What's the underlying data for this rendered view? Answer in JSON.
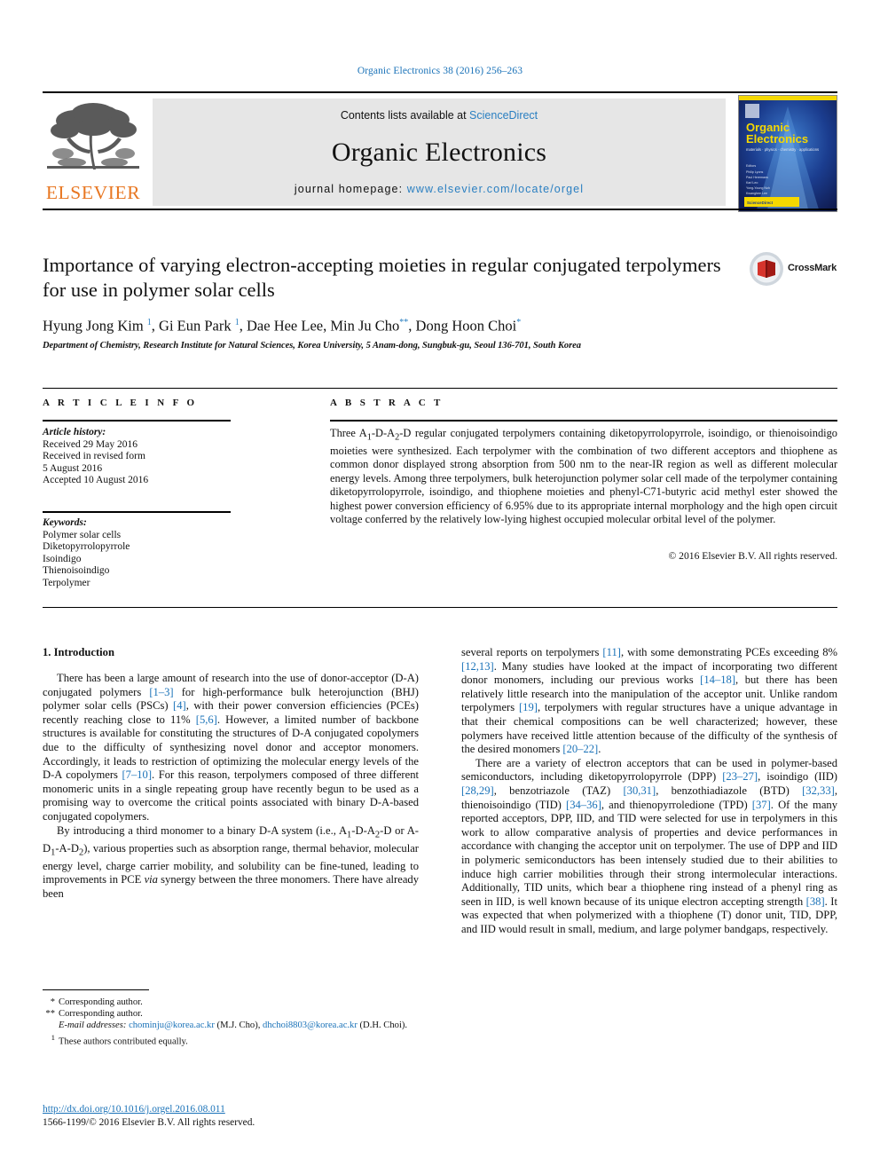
{
  "running_head": "Organic Electronics 38 (2016) 256–263",
  "masthead": {
    "contents_prefix": "Contents lists available at ",
    "sciencedirect": "ScienceDirect",
    "journal_title": "Organic Electronics",
    "homepage_prefix": "journal homepage: ",
    "homepage_url": "www.elsevier.com/locate/orgel",
    "publisher_logo_text": "ELSEVIER",
    "cover_title_line1": "Organic",
    "cover_title_line2": "Electronics",
    "cover_subtitle": "materials · physics · chemistry · applications"
  },
  "colors": {
    "link": "#1a72b8",
    "sciencedirect": "#2a7fc1",
    "elsevier_orange": "#E87722",
    "band_gray": "#e6e6e6",
    "cover_blue": "#1d2b6b",
    "cover_yellow": "#f5d800"
  },
  "article": {
    "title": "Importance of varying electron-accepting moieties in regular conjugated terpolymers for use in polymer solar cells",
    "authors_html": "Hyung Jong Kim <sup>1</sup>, Gi Eun Park <sup>1</sup>, Dae Hee Lee, Min Ju Cho<sup class=\"star\">**</sup>, Dong Hoon Choi<sup class=\"star\">*</sup>",
    "affiliation": "Department of Chemistry, Research Institute for Natural Sciences, Korea University, 5 Anam-dong, Sungbuk-gu, Seoul 136-701, South Korea",
    "crossmark_label": "CrossMark"
  },
  "article_info": {
    "heading": "A R T I C L E  I N F O",
    "history_label": "Article history:",
    "history": [
      "Received 29 May 2016",
      "Received in revised form",
      "5 August 2016",
      "Accepted 10 August 2016"
    ],
    "keywords_label": "Keywords:",
    "keywords": [
      "Polymer solar cells",
      "Diketopyrrolopyrrole",
      "Isoindigo",
      "Thienoisoindigo",
      "Terpolymer"
    ]
  },
  "abstract": {
    "heading": "A B S T R A C T",
    "text": "Three A1-D-A2-D regular conjugated terpolymers containing diketopyrrolopyrrole, isoindigo, or thienoisoindigo moieties were synthesized. Each terpolymer with the combination of two different acceptors and thiophene as common donor displayed strong absorption from 500 nm to the near-IR region as well as different molecular energy levels. Among three terpolymers, bulk heterojunction polymer solar cell made of the terpolymer containing diketopyrrolopyrrole, isoindigo, and thiophene moieties and phenyl-C71-butyric acid methyl ester showed the highest power conversion efficiency of 6.95% due to its appropriate internal morphology and the high open circuit voltage conferred by the relatively low-lying highest occupied molecular orbital level of the polymer.",
    "copyright": "© 2016 Elsevier B.V. All rights reserved."
  },
  "body": {
    "section_title": "1. Introduction",
    "left_paragraphs": [
      "There has been a large amount of research into the use of donor-acceptor (D-A) conjugated polymers [1–3] for high-performance bulk heterojunction (BHJ) polymer solar cells (PSCs) [4], with their power conversion efficiencies (PCEs) recently reaching close to 11% [5,6]. However, a limited number of backbone structures is available for constituting the structures of D-A conjugated copolymers due to the difficulty of synthesizing novel donor and acceptor monomers. Accordingly, it leads to restriction of optimizing the molecular energy levels of the D-A copolymers [7–10]. For this reason, terpolymers composed of three different monomeric units in a single repeating group have recently begun to be used as a promising way to overcome the critical points associated with binary D-A-based conjugated copolymers.",
      "By introducing a third monomer to a binary D-A system (i.e., A1-D-A2-D or A-D1-A-D2), various properties such as absorption range, thermal behavior, molecular energy level, charge carrier mobility, and solubility can be fine-tuned, leading to improvements in PCE via synergy between the three monomers. There have already been"
    ],
    "right_paragraphs": [
      "several reports on terpolymers [11], with some demonstrating PCEs exceeding 8% [12,13]. Many studies have looked at the impact of incorporating two different donor monomers, including our previous works [14–18], but there has been relatively little research into the manipulation of the acceptor unit. Unlike random terpolymers [19], terpolymers with regular structures have a unique advantage in that their chemical compositions can be well characterized; however, these polymers have received little attention because of the difficulty of the synthesis of the desired monomers [20–22].",
      "There are a variety of electron acceptors that can be used in polymer-based semiconductors, including diketopyrrolopyrrole (DPP) [23–27], isoindigo (IID) [28,29], benzotriazole (TAZ) [30,31], benzothiadiazole (BTD) [32,33], thienoisoindigo (TID) [34–36], and thienopyrroledione (TPD) [37]. Of the many reported acceptors, DPP, IID, and TID were selected for use in terpolymers in this work to allow comparative analysis of properties and device performances in accordance with changing the acceptor unit on terpolymer. The use of DPP and IID in polymeric semiconductors has been intensely studied due to their abilities to induce high carrier mobilities through their strong intermolecular interactions. Additionally, TID units, which bear a thiophene ring instead of a phenyl ring as seen in IID, is well known because of its unique electron accepting strength [38]. It was expected that when polymerized with a thiophene (T) donor unit, TID, DPP, and IID would result in small, medium, and large polymer bandgaps, respectively."
    ]
  },
  "footnotes": {
    "corresponding_1": "Corresponding author.",
    "corresponding_2": "Corresponding author.",
    "email_label": "E-mail addresses:",
    "email_1": "chominju@korea.ac.kr",
    "email_1_owner": "(M.J. Cho)",
    "email_2": "dhchoi8803@korea.ac.kr",
    "email_2_owner": "(D.H. Choi).",
    "equal_contribution": "These authors contributed equally.",
    "doi": "http://dx.doi.org/10.1016/j.orgel.2016.08.011",
    "issn_line": "1566-1199/© 2016 Elsevier B.V. All rights reserved."
  }
}
